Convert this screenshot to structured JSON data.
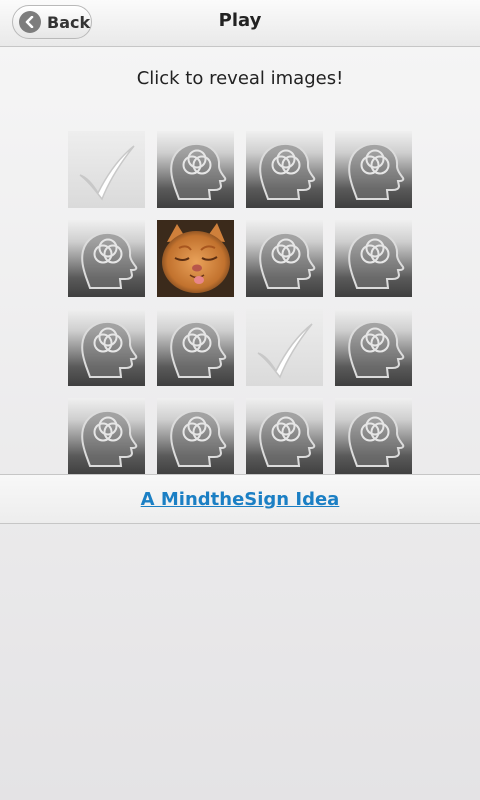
{
  "header": {
    "back_label": "Back",
    "title": "Play"
  },
  "main": {
    "instructions": "Click to reveal images!",
    "tiles": [
      [
        "matched",
        "hidden",
        "hidden",
        "hidden"
      ],
      [
        "hidden",
        "revealed-cat",
        "hidden",
        "hidden"
      ],
      [
        "hidden",
        "hidden",
        "matched",
        "hidden"
      ],
      [
        "hidden",
        "hidden",
        "hidden",
        "hidden"
      ]
    ]
  },
  "footer": {
    "link_label": "A MindtheSign Idea"
  },
  "colors": {
    "link": "#1b7fc4",
    "tile_dark": "#3f3f3f",
    "tile_light": "#f0f0f0"
  },
  "icons": {
    "hidden_tile": "head-rings-icon",
    "matched_tile": "checkmark-icon",
    "revealed_tile": "cat-image"
  }
}
